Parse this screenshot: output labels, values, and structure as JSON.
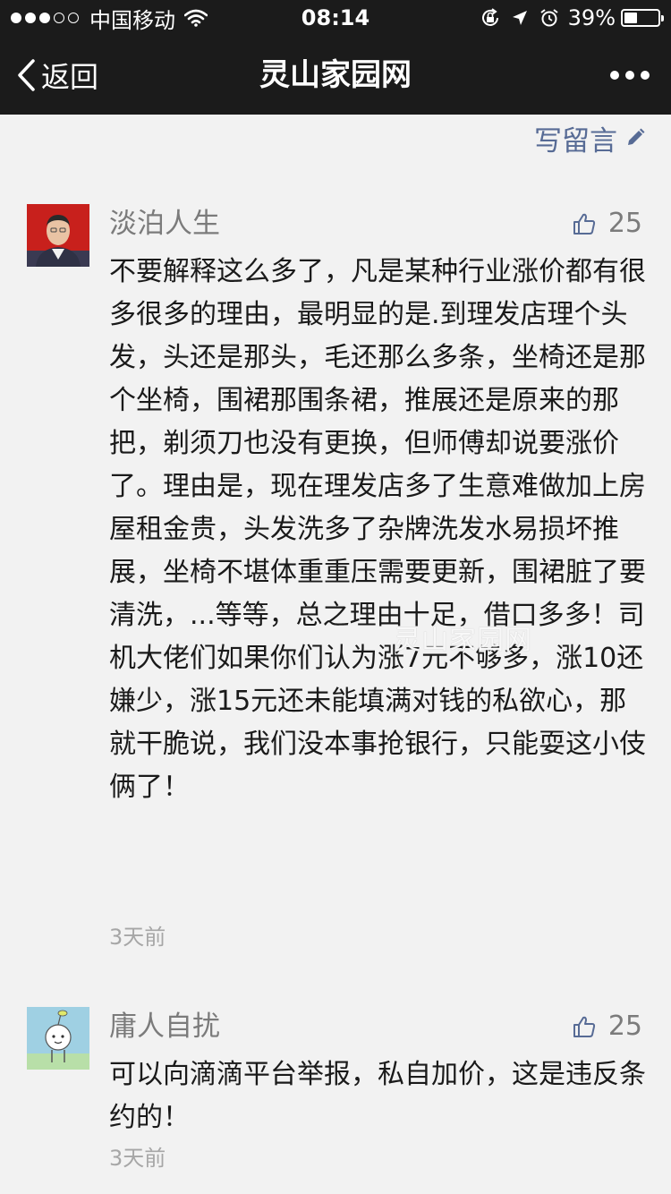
{
  "status_bar": {
    "signal_dots_filled": 3,
    "signal_dots_total": 5,
    "carrier": "中国移动",
    "time": "08:14",
    "battery_percent": "39%",
    "battery_level": 0.39
  },
  "nav": {
    "back_label": "返回",
    "title": "灵山家园网"
  },
  "write_comment": {
    "label": "写留言"
  },
  "comments": [
    {
      "name": "淡泊人生",
      "likes": "25",
      "text": "不要解释这么多了，凡是某种行业涨价都有很多很多的理由，最明显的是.到理发店理个头发，头还是那头，毛还那么多条，坐椅还是那个坐椅，围裙那围条裙，推展还是原来的那把，剃须刀也没有更换，但师傅却说要涨价了。理由是，现在理发店多了生意难做加上房屋租金贵，头发洗多了杂牌洗发水易损坏推展，坐椅不堪体重重压需要更新，围裙脏了要清洗，...等等，总之理由十足，借口多多！司机大佬们如果你们认为涨7元不够多，涨10还嫌少，涨15元还未能填满对钱的私欲心，那就干脆说，我们没本事抢银行，只能耍这小伎俩了！",
      "time": "3天前"
    },
    {
      "name": "庸人自扰",
      "likes": "25",
      "text": "可以向滴滴平台举报，私自加价，这是违反条约的！",
      "time": "3天前"
    }
  ],
  "watermark": "灵山家园网",
  "colors": {
    "bar_background": "#1b1b1b",
    "page_background": "#f2f2f2",
    "link_blue": "#576b95",
    "secondary_text": "#7b7b7b"
  }
}
